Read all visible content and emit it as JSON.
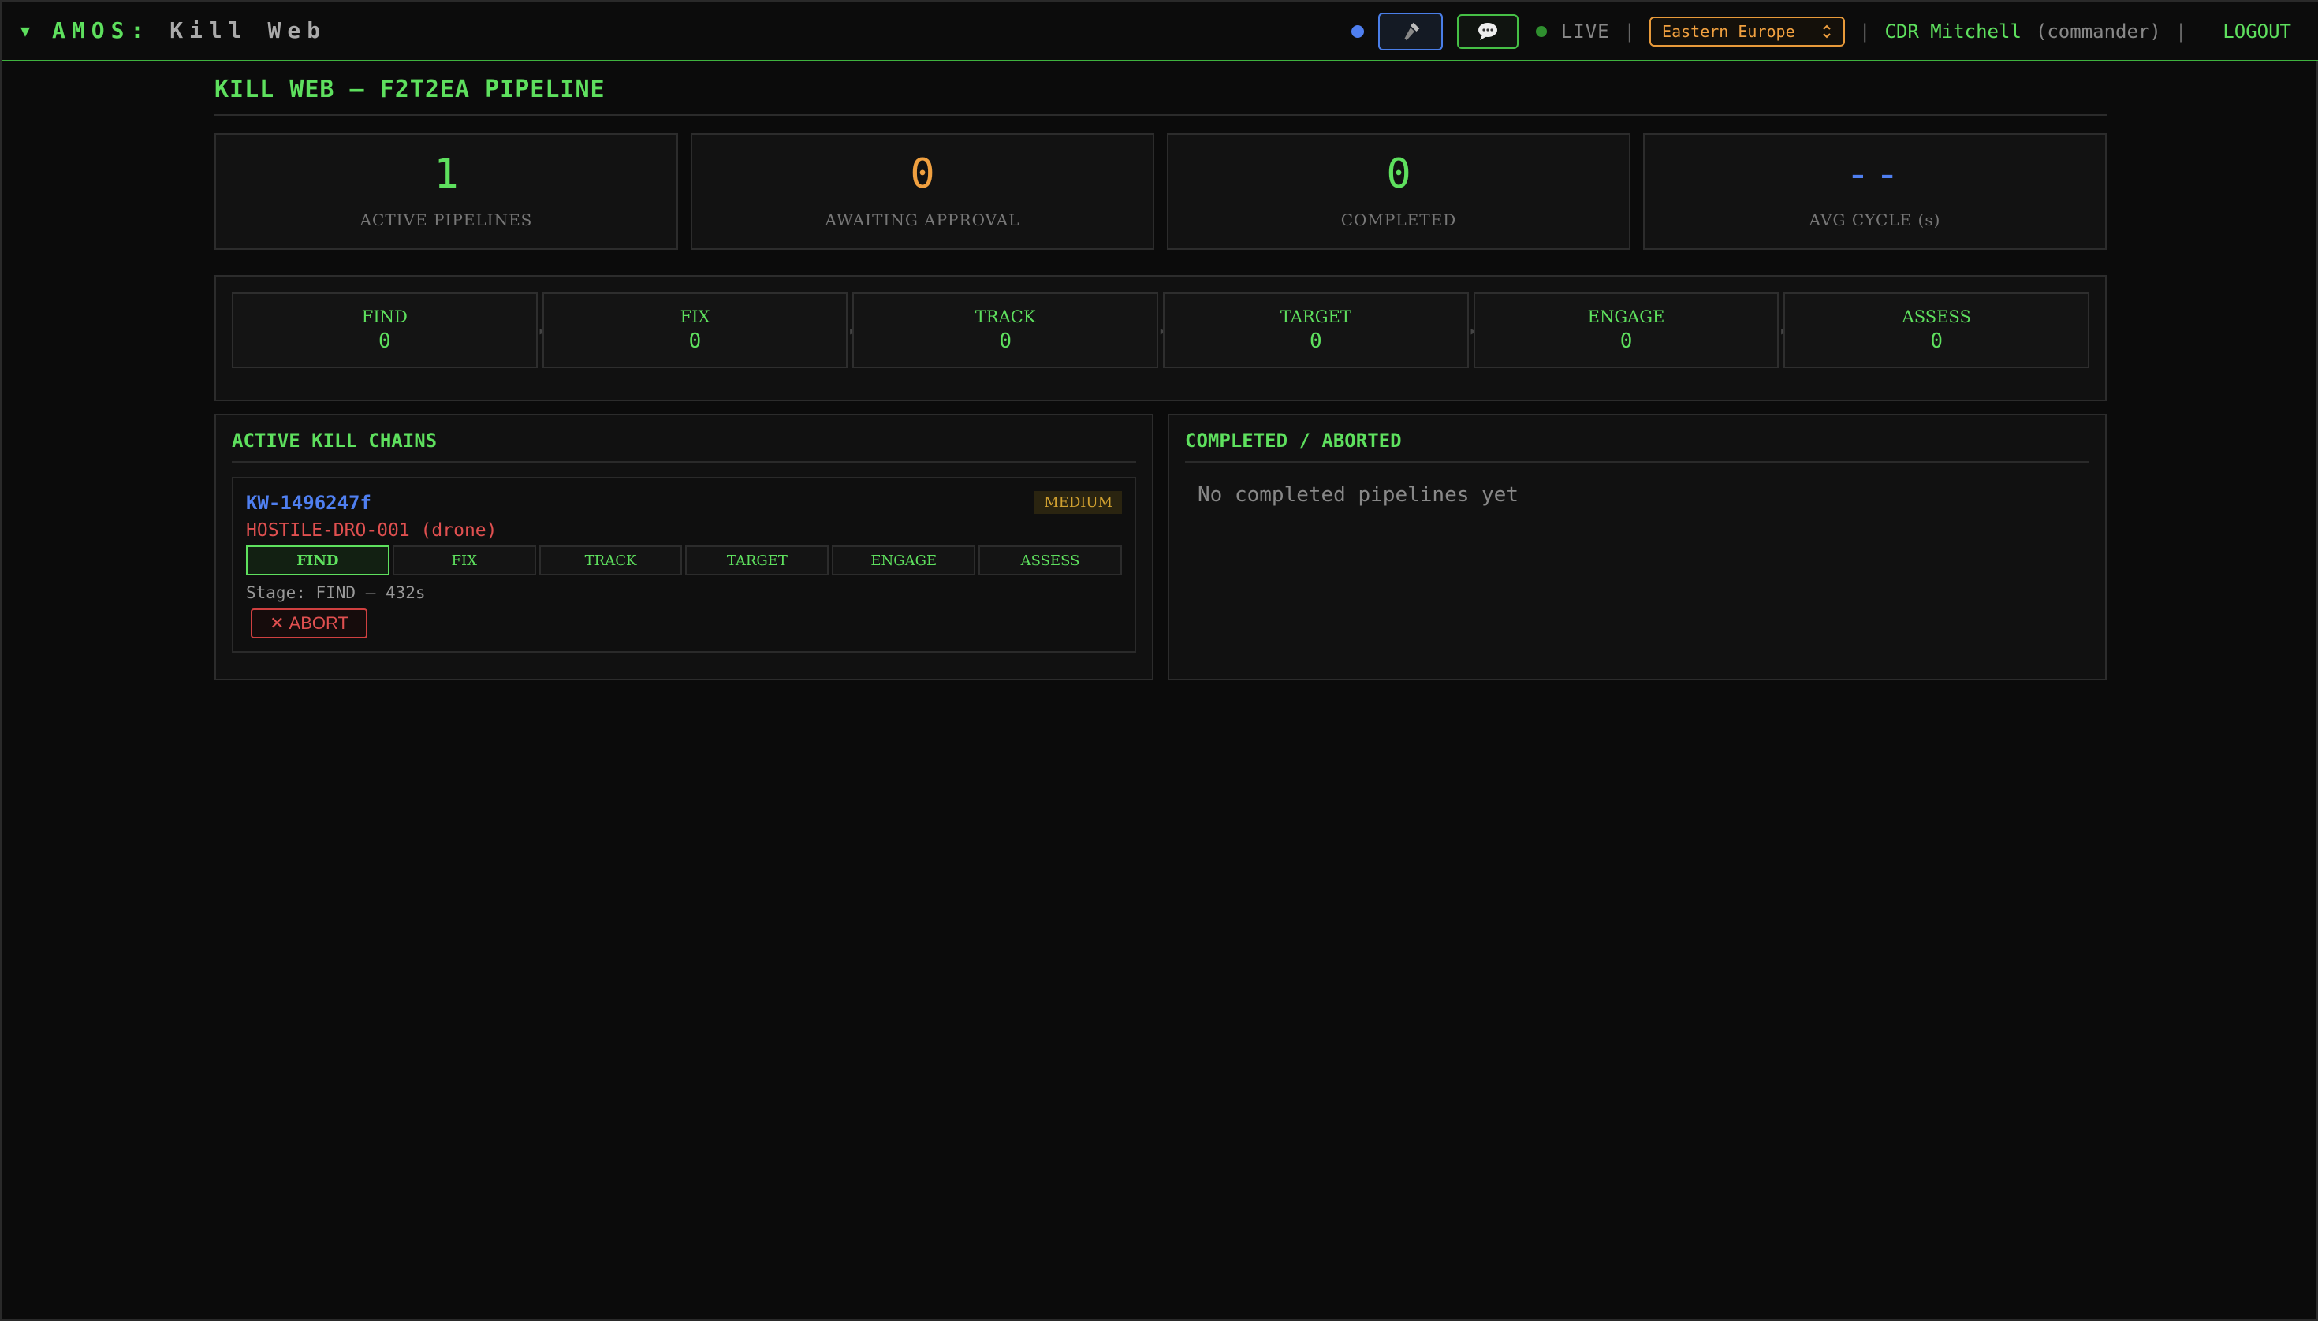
{
  "header": {
    "collapse_glyph": "▼",
    "brand": "AMOS:",
    "brand_sub": "Kill Web",
    "status": "LIVE",
    "region": "Eastern Europe",
    "user": "CDR Mitchell",
    "role": "(commander)",
    "logout": "LOGOUT",
    "sep": "|"
  },
  "page": {
    "title": "KILL WEB — F2T2EA PIPELINE"
  },
  "stats": [
    {
      "value": "1",
      "label": "ACTIVE PIPELINES",
      "color": "#5ee05e"
    },
    {
      "value": "0",
      "label": "AWAITING APPROVAL",
      "color": "#f0a040"
    },
    {
      "value": "0",
      "label": "COMPLETED",
      "color": "#5ee05e"
    },
    {
      "value": "--",
      "label": "AVG CYCLE (s)",
      "color": "#4f7ff0"
    }
  ],
  "pipeline": {
    "stages": [
      {
        "name": "FIND",
        "count": "0"
      },
      {
        "name": "FIX",
        "count": "0"
      },
      {
        "name": "TRACK",
        "count": "0"
      },
      {
        "name": "TARGET",
        "count": "0"
      },
      {
        "name": "ENGAGE",
        "count": "0"
      },
      {
        "name": "ASSESS",
        "count": "0"
      }
    ]
  },
  "active_panel": {
    "title": "ACTIVE KILL CHAINS",
    "chain": {
      "id": "KW-1496247f",
      "priority": "MEDIUM",
      "target": "HOSTILE-DRO-001 (drone)",
      "stages": [
        "FIND",
        "FIX",
        "TRACK",
        "TARGET",
        "ENGAGE",
        "ASSESS"
      ],
      "stage_line": "Stage: FIND — 432s",
      "abort_label": "ABORT",
      "abort_glyph": "✕"
    }
  },
  "completed_panel": {
    "title": "COMPLETED / ABORTED",
    "empty": "No completed pipelines yet"
  }
}
